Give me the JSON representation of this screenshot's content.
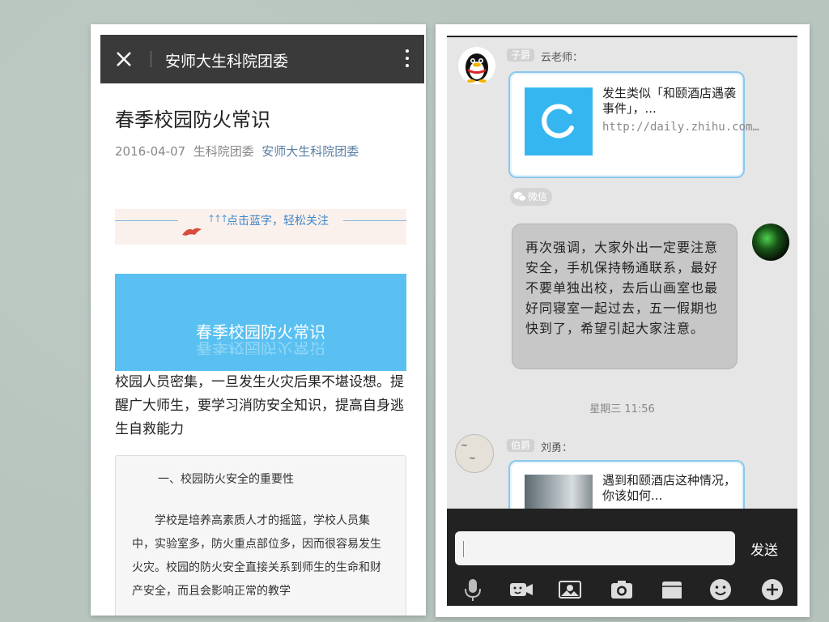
{
  "article": {
    "topbar_title": "安师大生科院团委",
    "title": "春季校园防火常识",
    "date": "2016-04-07",
    "author": "生科院团委",
    "account_link": "安师大生科院团委",
    "follow_text": "点击蓝字，轻松关注",
    "follow_arrows": "↑↑↑",
    "hero_title": "春季校园防火常识",
    "intro": "校园人员密集，一旦发生火灾后果不堪设想。提醒广大师生，要学习消防安全知识，提高自身逃生自救能力",
    "section_heading": "一、校园防火安全的重要性",
    "section_body": "学校是培养高素质人才的摇篮，学校人员集中，实验室多，防火重点部位多，因而很容易发生火灾。校园的防火安全直接关系到师生的生命和财产安全，而且会影响正常的教学"
  },
  "chat": {
    "msg1": {
      "tag": "子爵",
      "name": "云老师：",
      "card_title": "发生类似「和颐酒店遇袭事件」，...",
      "card_url": "http://daily.zhihu.com…"
    },
    "source_badge": "微信",
    "msg2_text": "再次强调，大家外出一定要注意安全，手机保持畅通联系，最好不要单独出校，去后山画室也最好同寝室一起过去，五一假期也快到了，希望引起大家注意。",
    "timestamp": "星期三 11:56",
    "msg3": {
      "tag": "伯爵",
      "name": "刘勇：",
      "card_title": "遇到和颐酒店这种情况，你该如何..."
    },
    "input_value": "",
    "send_label": "发送"
  },
  "icons": {
    "close": "close-icon",
    "more": "more-vert-icon",
    "mic": "microphone-icon",
    "video": "video-icon",
    "photo": "image-icon",
    "camera": "camera-icon",
    "folder": "folder-icon",
    "emoji": "emoji-icon",
    "add": "plus-icon"
  },
  "colors": {
    "topbar": "#3a3a3a",
    "hero": "#59c0f1",
    "link_blue": "#5b7ea6",
    "bubble_border": "#8cc8ec",
    "app_icon": "#36b6f0",
    "input_bar": "#222222"
  }
}
